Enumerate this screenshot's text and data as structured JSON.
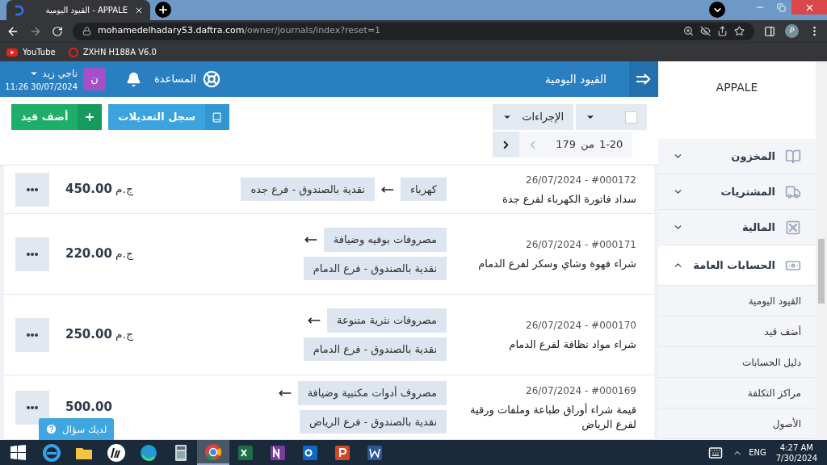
{
  "browser": {
    "tab_title": "القيود اليومية - APPALE",
    "url_host": "mohamedelhadary53.daftra.com",
    "url_path": "/owner/journals/index?reset=1",
    "profile_letter": "P",
    "bookmark_video_site": "YouTube",
    "bookmark_router": "ZXHN H188A V6.0"
  },
  "header": {
    "user_name": "ناجي زيد",
    "datetime": "11:26 30/07/2024",
    "avatar_letter": "ن",
    "help": "المساعدة",
    "page_title": "القيود اليومية"
  },
  "toolbar": {
    "select_all": {
      "checked": false
    },
    "actions": "الإجراءات",
    "range": "1-20",
    "of": "من",
    "total": "179",
    "prev": {
      "disabled": true
    },
    "next": {
      "disabled": false
    },
    "audit_log": "سجل التعديلات",
    "add_entry": "أضف قيد"
  },
  "entries": [
    {
      "kind": "inline",
      "ref": "26/07/2024 - #000172",
      "description": "سداد فاتورة الكهرباء لفرع جدة",
      "debit": "كهرباء",
      "credit": "نقدية بالصندوق - فرع جده",
      "amount": "450.00",
      "currency": "ج.م"
    },
    {
      "kind": "stacked",
      "ref": "26/07/2024 - #000171",
      "description": "شراء فهوة وشاي وسكر لفرع الدمام",
      "debit": "مصروفات بوفيه وضيافة",
      "credit": "نقدية بالصندوق - فرع الدمام",
      "amount": "220.00",
      "currency": "ج.م"
    },
    {
      "kind": "stacked",
      "ref": "26/07/2024 - #000170",
      "description": "شراء مواد نظافة لفرع الدمام",
      "debit": "مصروفات نثرية متنوعة",
      "credit": "نقدية بالصندوق - فرع الدمام",
      "amount": "250.00",
      "currency": "ج.م"
    },
    {
      "kind": "stacked",
      "ref": "26/07/2024 - #000169",
      "description": "قيمة شراء أوراق طباعة وملفات ورقية لفرع الرياض",
      "debit": "مصروف أدوات مكتبية وضيافة",
      "credit": "نقدية بالصندوق - فرع الرياض",
      "amount": "500.00"
    }
  ],
  "help_button": "لديك سؤال",
  "sidebar": {
    "brand": "APPALE",
    "items": [
      {
        "label": "المخزون",
        "kind": "inventory",
        "expanded": false
      },
      {
        "label": "المشتريات",
        "kind": "purchases",
        "expanded": false
      },
      {
        "label": "المالية",
        "kind": "finance",
        "expanded": false
      },
      {
        "label": "الحسابات العامة",
        "kind": "accounts",
        "expanded": true,
        "children": [
          {
            "label": "القيود اليومية"
          },
          {
            "label": "أضف قيد"
          },
          {
            "label": "دليل الحسابات"
          },
          {
            "label": "مراكز التكلفة"
          },
          {
            "label": "الأصول"
          }
        ]
      }
    ]
  },
  "taskbar": {
    "apps": [
      {
        "kind": "ie",
        "selected": false
      },
      {
        "kind": "folder",
        "selected": false
      },
      {
        "kind": "hp",
        "selected": false
      },
      {
        "kind": "edge",
        "selected": false
      },
      {
        "kind": "calculator",
        "selected": false
      },
      {
        "kind": "chrome",
        "selected": true
      },
      {
        "kind": "excel",
        "selected": false
      },
      {
        "kind": "onenote",
        "selected": false
      },
      {
        "kind": "outlook",
        "selected": false
      },
      {
        "kind": "powerpoint",
        "selected": false
      },
      {
        "kind": "word",
        "selected": false
      }
    ],
    "language": "ENG",
    "time": "4:27 AM",
    "date": "7/30/2024"
  }
}
